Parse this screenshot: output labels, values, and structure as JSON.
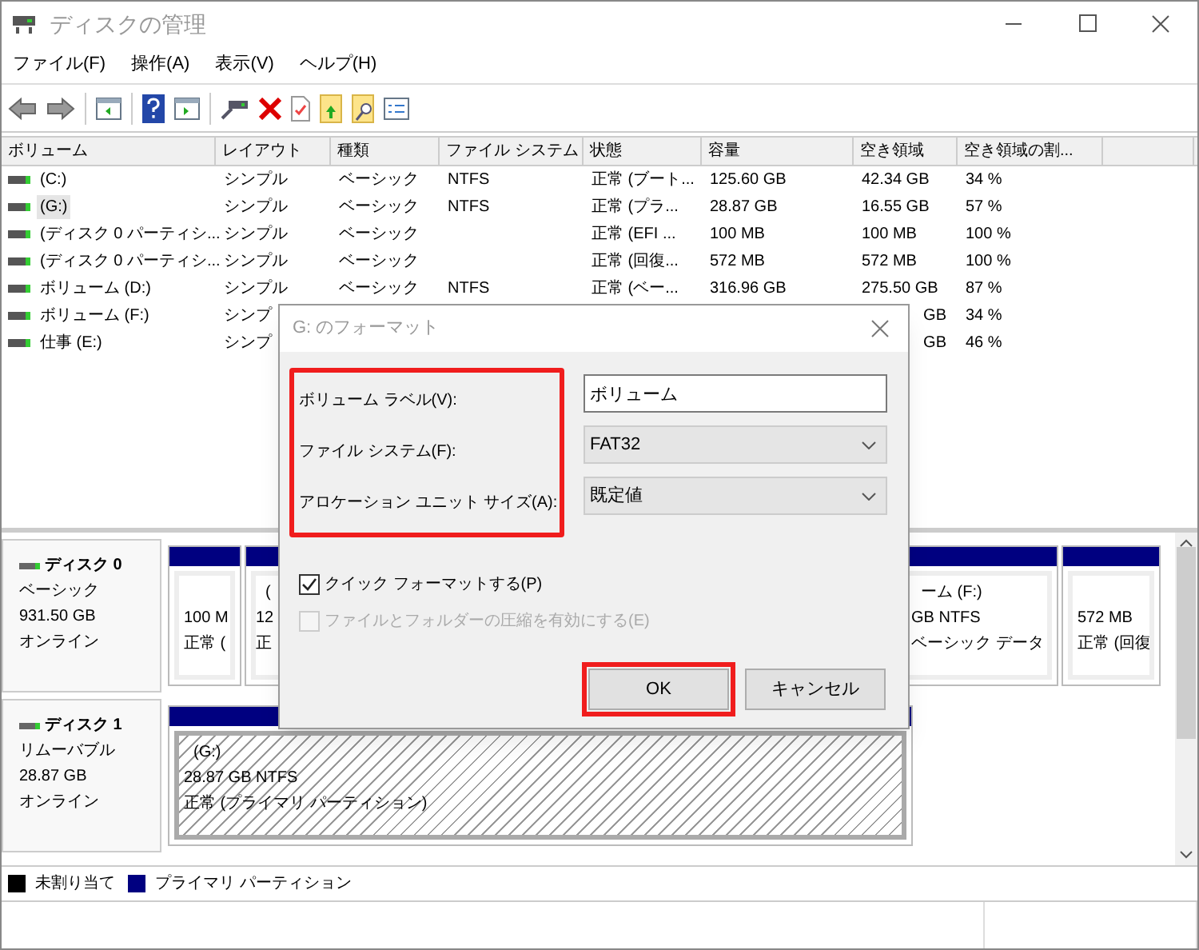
{
  "window": {
    "title": "ディスクの管理"
  },
  "menu": [
    "ファイル(F)",
    "操作(A)",
    "表示(V)",
    "ヘルプ(H)"
  ],
  "volume_table": {
    "columns": [
      "ボリューム",
      "レイアウト",
      "種類",
      "ファイル システム",
      "状態",
      "容量",
      "空き領域",
      "空き領域の割..."
    ],
    "rows": [
      {
        "volume": "(C:)",
        "layout": "シンプル",
        "type": "ベーシック",
        "file_system": "NTFS",
        "status": "正常 (ブート...",
        "capacity": "125.60 GB",
        "free_space": "42.34 GB",
        "percent_free": "34 %",
        "selected": false
      },
      {
        "volume": "(G:)",
        "layout": "シンプル",
        "type": "ベーシック",
        "file_system": "NTFS",
        "status": "正常 (プラ...",
        "capacity": "28.87 GB",
        "free_space": "16.55 GB",
        "percent_free": "57 %",
        "selected": true
      },
      {
        "volume": "(ディスク 0 パーティシ...",
        "layout": "シンプル",
        "type": "ベーシック",
        "status": "正常 (EFI ...",
        "capacity": "100 MB",
        "free_space": "100 MB",
        "percent_free": "100 %",
        "selected": false
      },
      {
        "volume": "(ディスク 0 パーティシ...",
        "layout": "シンプル",
        "type": "ベーシック",
        "status": "正常 (回復...",
        "capacity": "572 MB",
        "free_space": "572 MB",
        "percent_free": "100 %",
        "selected": false
      },
      {
        "volume": "ボリューム (D:)",
        "layout": "シンプル",
        "type": "ベーシック",
        "file_system": "NTFS",
        "status": "正常 (ベー...",
        "capacity": "316.96 GB",
        "free_space": "275.50 GB",
        "percent_free": "87 %",
        "selected": false
      },
      {
        "volume": "ボリューム (F:)",
        "layout": "シンプ",
        "free_space": "GB",
        "percent_free": "34 %",
        "selected": false
      },
      {
        "volume": "仕事 (E:)",
        "layout": "シンプ",
        "free_space": "GB",
        "percent_free": "46 %",
        "selected": false
      }
    ]
  },
  "disks": [
    {
      "name": "ディスク 0",
      "type": "ベーシック",
      "size": "931.50 GB",
      "status": "オンライン",
      "partitions": [
        {
          "lines": [
            "100 M",
            "正常 ("
          ],
          "selected": false
        },
        {
          "label": "(",
          "lines": [
            "12",
            "正"
          ],
          "selected": false
        },
        {
          "label": "ーム (F:)",
          "lines": [
            "GB NTFS",
            "ベーシック データ"
          ],
          "selected": false
        },
        {
          "lines": [
            "572 MB",
            "正常 (回復"
          ],
          "selected": false
        }
      ]
    },
    {
      "name": "ディスク 1",
      "type": "リムーバブル",
      "size": "28.87 GB",
      "status": "オンライン",
      "partitions": [
        {
          "label": "(G:)",
          "lines": [
            "28.87 GB NTFS",
            "正常 (プライマリ パーティション)"
          ],
          "selected": true
        }
      ]
    }
  ],
  "legend": [
    {
      "label": "未割り当て",
      "color": "#000000"
    },
    {
      "label": "プライマリ パーティション",
      "color": "#000080"
    }
  ],
  "dialog": {
    "title": "G: のフォーマット",
    "labels_highlighted": true,
    "fields": [
      {
        "label": "ボリューム ラベル(V):",
        "value": "ボリューム",
        "kind": "text"
      },
      {
        "label": "ファイル システム(F):",
        "value": "FAT32",
        "kind": "dropdown"
      },
      {
        "label": "アロケーション ユニット サイズ(A):",
        "value": "既定値",
        "kind": "dropdown"
      }
    ],
    "checkboxes": [
      {
        "label": "クイック フォーマットする(P)",
        "checked": true,
        "disabled": false
      },
      {
        "label": "ファイルとフォルダーの圧縮を有効にする(E)",
        "checked": false,
        "disabled": true
      }
    ],
    "buttons": [
      {
        "label": "OK",
        "highlighted": true
      },
      {
        "label": "キャンセル",
        "highlighted": false
      }
    ]
  }
}
